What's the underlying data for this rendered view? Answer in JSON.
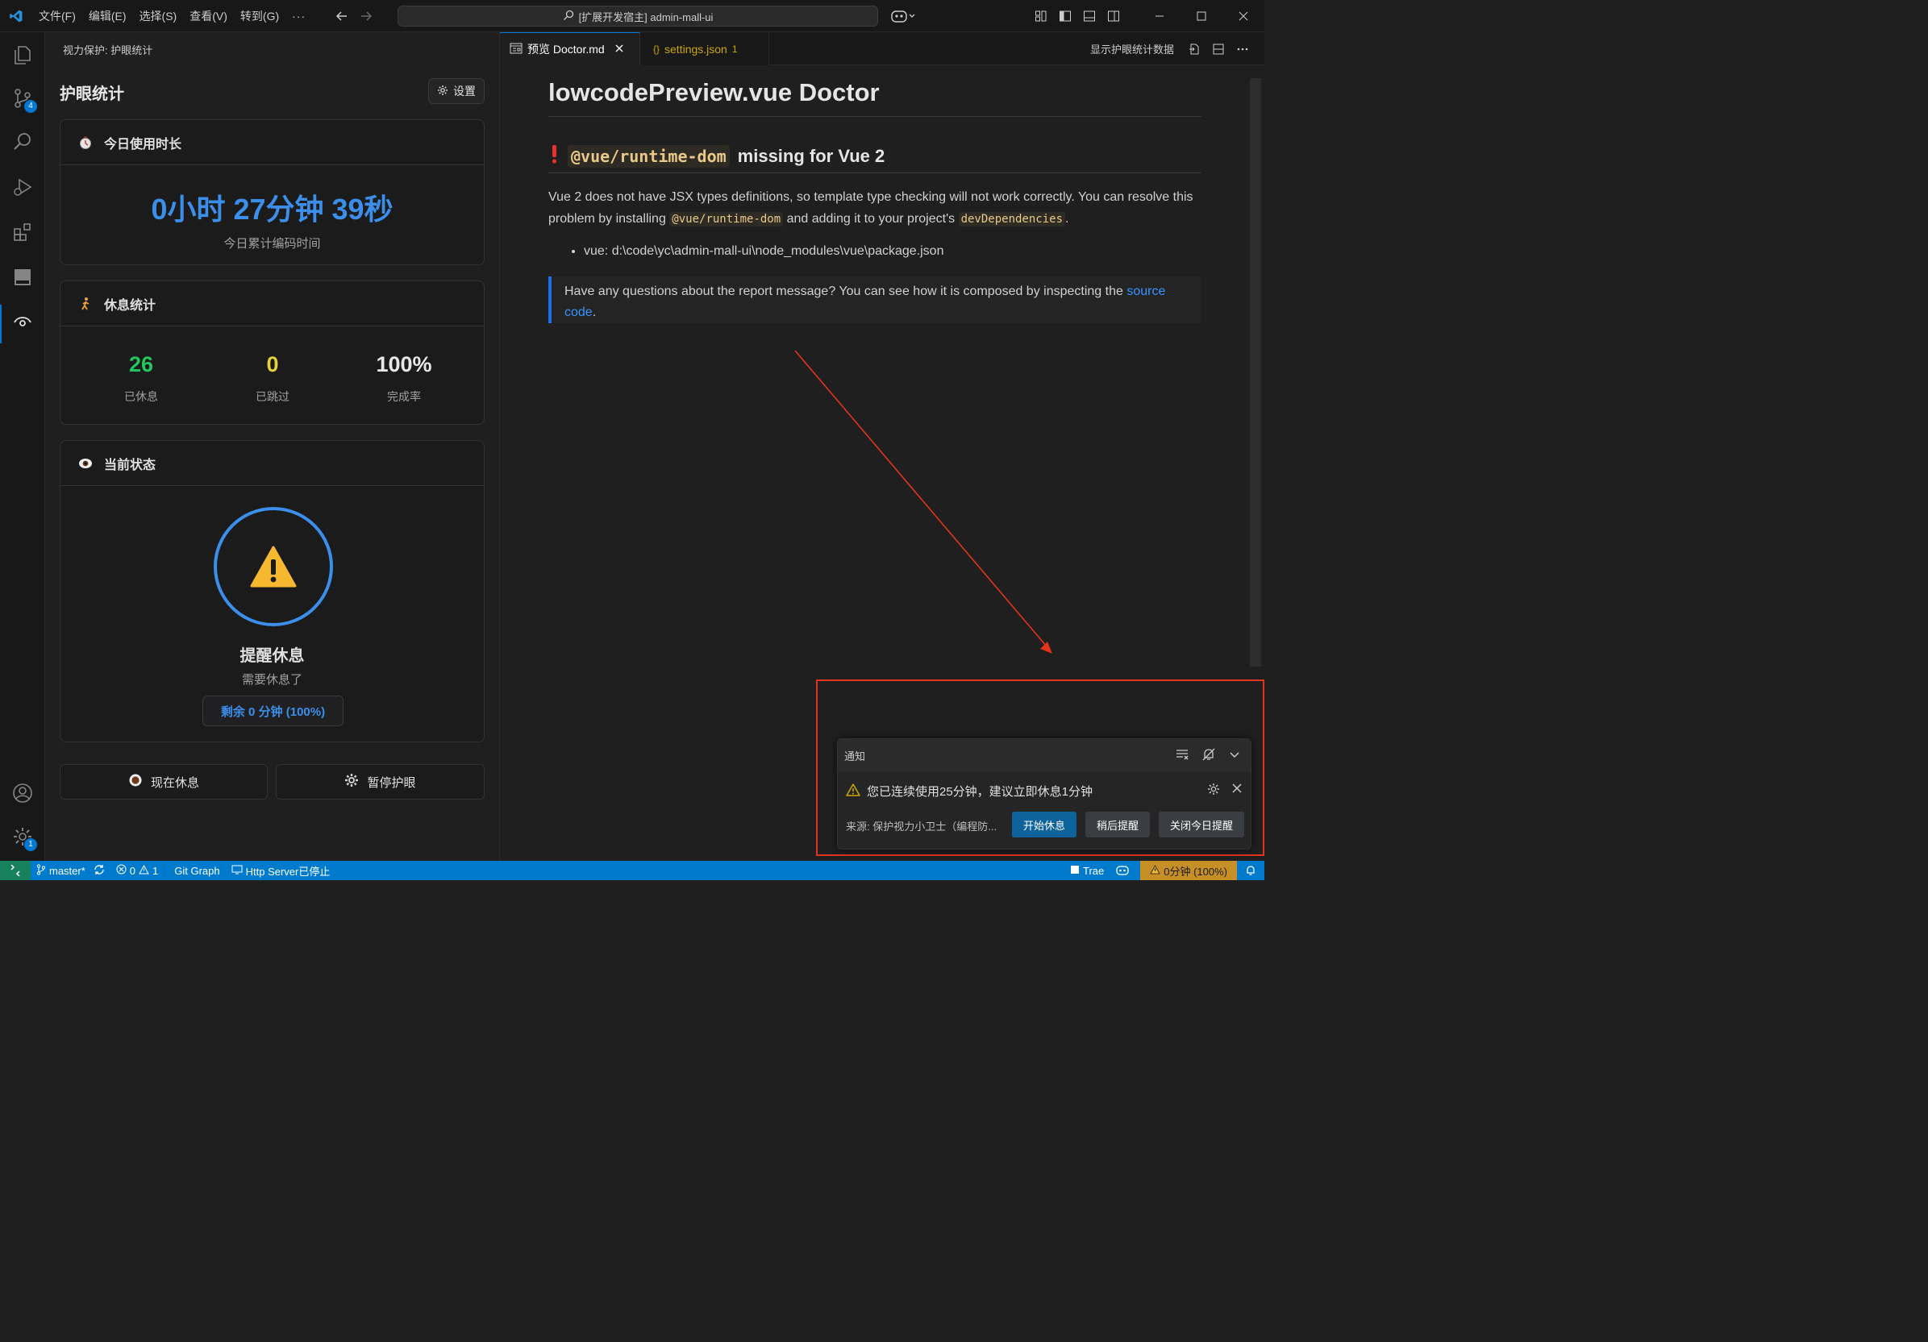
{
  "titlebar": {
    "menus": [
      "文件(F)",
      "编辑(E)",
      "选择(S)",
      "查看(V)",
      "转到(G)",
      "···"
    ],
    "command_center": "[扩展开发宿主] admin-mall-ui"
  },
  "activity_badges": {
    "source_control": "4",
    "settings": "1"
  },
  "sidebar": {
    "title": "视力保护: 护眼统计",
    "heading": "护眼统计",
    "settings_label": "设置",
    "today": {
      "title": "今日使用时长",
      "time": "0小时 27分钟 39秒",
      "subtitle": "今日累计编码时间"
    },
    "rest": {
      "title": "休息统计",
      "stats": [
        {
          "value": "26",
          "label": "已休息",
          "color": "#23c55e"
        },
        {
          "value": "0",
          "label": "已跳过",
          "color": "#e5d13a"
        },
        {
          "value": "100%",
          "label": "完成率",
          "color": "#e8e8e8"
        }
      ]
    },
    "status": {
      "title": "当前状态",
      "state": "提醒休息",
      "desc": "需要休息了",
      "remaining": "剩余 0 分钟 (100%)"
    },
    "actions": {
      "rest_now": "现在休息",
      "pause": "暂停护眼"
    }
  },
  "editor": {
    "tabs": [
      {
        "label": "预览 Doctor.md"
      },
      {
        "label": "settings.json",
        "problems": "1"
      }
    ],
    "actions_label": "显示护眼统计数据"
  },
  "preview": {
    "h1": "lowcodePreview.vue Doctor",
    "h2_code": "@vue/runtime-dom",
    "h2_text": "missing for Vue 2",
    "para_1": "Vue 2 does not have JSX types definitions, so template type checking will not work correctly. You can resolve this problem by installing ",
    "para_code_1": "@vue/runtime-dom",
    "para_2": " and adding it to your project's ",
    "para_code_2": "devDependencies",
    "para_3": ".",
    "list_item": "vue: d:\\code\\yc\\admin-mall-ui\\node_modules\\vue\\package.json",
    "quote_text": "Have any questions about the report message? You can see how it is composed by inspecting the ",
    "quote_link": "source code",
    "quote_end": "."
  },
  "notification": {
    "header": "通知",
    "message": "您已连续使用25分钟，建议立即休息1分钟",
    "source": "来源: 保护视力小卫士（编程防...",
    "buttons": {
      "start": "开始休息",
      "later": "稍后提醒",
      "close_today": "关闭今日提醒"
    }
  },
  "statusbar": {
    "branch": "master*",
    "errors": "0",
    "warnings": "1",
    "git_graph": "Git Graph",
    "http_server": "Http Server已停止",
    "trae": "Trae",
    "eye_status": "0分钟 (100%)"
  }
}
